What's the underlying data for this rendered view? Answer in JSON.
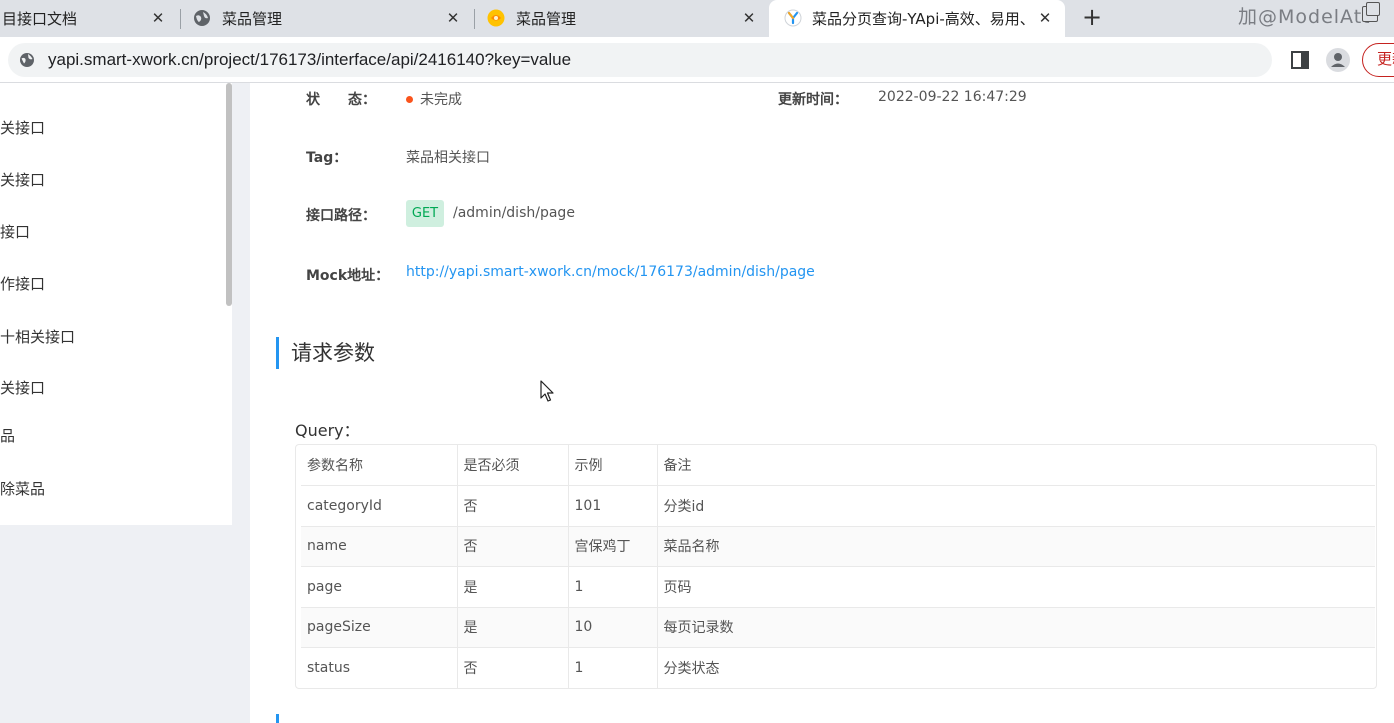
{
  "tabs": [
    {
      "title": "目接口文档",
      "close": "✕"
    },
    {
      "title": "菜品管理",
      "close": "✕"
    },
    {
      "title": "菜品管理",
      "close": "✕"
    },
    {
      "title": "菜品分页查询-YApi-高效、易用、",
      "close": "✕"
    }
  ],
  "new_tab": "+",
  "watermark": "加@ModelAtt",
  "address": {
    "url": "yapi.smart-xwork.cn/project/176173/interface/api/2416140?key=value"
  },
  "update_button": "更新",
  "sidebar": {
    "items": [
      "关接口",
      "关接口",
      "接口",
      "作接口",
      "十相关接口",
      "关接口",
      "品",
      "除菜品"
    ]
  },
  "info": {
    "status_label": "状　　态：",
    "status_value": "未完成",
    "updated_label": "更新时间：",
    "updated_value": "2022-09-22 16:47:29",
    "tag_label": "Tag：",
    "tag_value": "菜品相关接口",
    "path_label": "接口路径：",
    "method": "GET",
    "path": "/admin/dish/page",
    "mock_label": "Mock地址：",
    "mock_url": "http://yapi.smart-xwork.cn/mock/176173/admin/dish/page"
  },
  "request_params": {
    "title": "请求参数",
    "query_label": "Query：",
    "columns": [
      "参数名称",
      "是否必须",
      "示例",
      "备注"
    ],
    "rows": [
      [
        "categoryId",
        "否",
        "101",
        "分类id"
      ],
      [
        "name",
        "否",
        "宫保鸡丁",
        "菜品名称"
      ],
      [
        "page",
        "是",
        "1",
        "页码"
      ],
      [
        "pageSize",
        "是",
        "10",
        "每页记录数"
      ],
      [
        "status",
        "否",
        "1",
        "分类状态"
      ]
    ]
  },
  "colors": {
    "accent": "#2395f1",
    "get_bg": "#cfefdf",
    "get_text": "#00a854",
    "status_dot": "#fa541c"
  }
}
